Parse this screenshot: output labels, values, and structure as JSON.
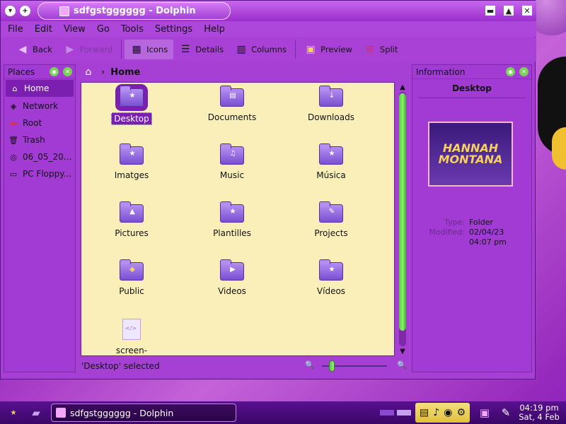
{
  "window": {
    "title": "sdfgstgggggg - Dolphin",
    "controls": {
      "minimize": "▬",
      "maximize": "▲",
      "close": "✕"
    }
  },
  "menubar": {
    "items": [
      "File",
      "Edit",
      "View",
      "Go",
      "Tools",
      "Settings",
      "Help"
    ]
  },
  "toolbar": {
    "back": "Back",
    "forward": "Forward",
    "icons": "Icons",
    "details": "Details",
    "columns": "Columns",
    "preview": "Preview",
    "split": "Split"
  },
  "places": {
    "title": "Places",
    "items": [
      {
        "label": "Home",
        "icon": "home-icon",
        "selected": true
      },
      {
        "label": "Network",
        "icon": "network-icon"
      },
      {
        "label": "Root",
        "icon": "root-folder-icon"
      },
      {
        "label": "Trash",
        "icon": "trash-icon"
      },
      {
        "label": "06_05_20...",
        "icon": "cdrom-icon"
      },
      {
        "label": "PC Floppy...",
        "icon": "floppy-icon"
      }
    ]
  },
  "location": {
    "current": "Home"
  },
  "files": [
    {
      "name": "Desktop",
      "selected": true
    },
    {
      "name": "Documents"
    },
    {
      "name": "Downloads"
    },
    {
      "name": "Imatges"
    },
    {
      "name": "Music"
    },
    {
      "name": "Música"
    },
    {
      "name": "Pictures"
    },
    {
      "name": "Plantilles"
    },
    {
      "name": "Projects"
    },
    {
      "name": "Public"
    },
    {
      "name": "Videos"
    },
    {
      "name": "Vídeos"
    },
    {
      "name": "screen-"
    }
  ],
  "status": {
    "text": "'Desktop' selected"
  },
  "information": {
    "title": "Information",
    "name": "Desktop",
    "preview_text": "HANNAH MONTANA",
    "type_label": "Type:",
    "type_value": "Folder",
    "modified_label": "Modified:",
    "modified_value": "02/04/23",
    "modified_time": "04:07 pm"
  },
  "taskbar": {
    "task": "sdfgstgggggg - Dolphin",
    "time": "04:19 pm",
    "date": "Sat, 4 Feb"
  },
  "colors": {
    "accent": "#a640d4",
    "selection": "#7a1fb0",
    "fileview_bg": "#fbefb9"
  }
}
